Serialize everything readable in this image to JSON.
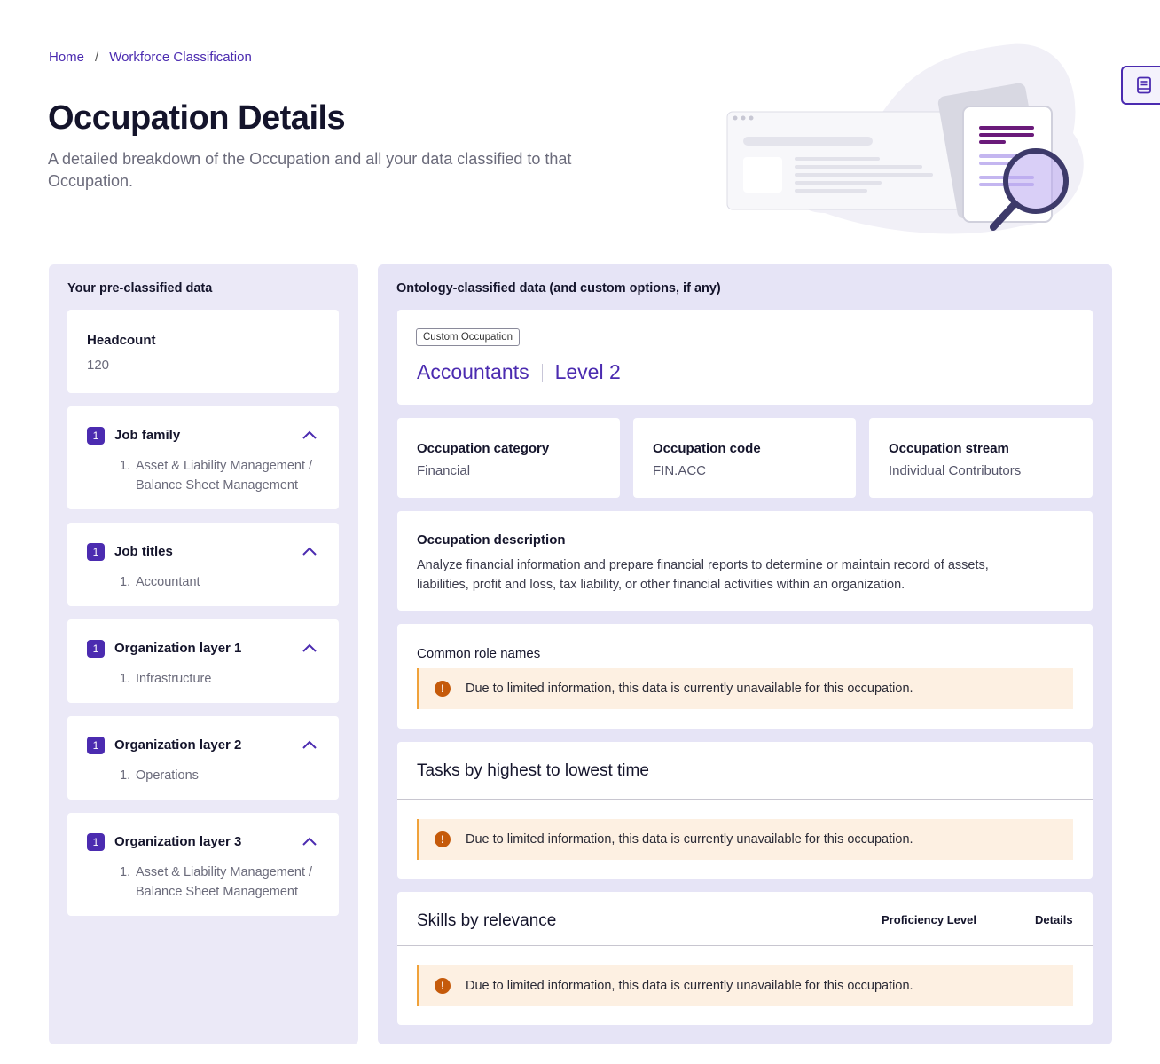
{
  "breadcrumb": {
    "home": "Home",
    "separator": "/",
    "current": "Workforce Classification"
  },
  "page": {
    "title": "Occupation Details",
    "subtitle": "A detailed breakdown of the Occupation and all your data classified to that Occupation."
  },
  "left_panel": {
    "heading": "Your pre-classified data",
    "headcount": {
      "label": "Headcount",
      "value": "120"
    },
    "groups": [
      {
        "badge": "1",
        "label": "Job family",
        "items": [
          {
            "num": "1.",
            "text": "Asset & Liability Management / Balance Sheet Management"
          }
        ]
      },
      {
        "badge": "1",
        "label": "Job titles",
        "items": [
          {
            "num": "1.",
            "text": "Accountant"
          }
        ]
      },
      {
        "badge": "1",
        "label": "Organization layer 1",
        "items": [
          {
            "num": "1.",
            "text": "Infrastructure"
          }
        ]
      },
      {
        "badge": "1",
        "label": "Organization layer 2",
        "items": [
          {
            "num": "1.",
            "text": "Operations"
          }
        ]
      },
      {
        "badge": "1",
        "label": "Organization layer 3",
        "items": [
          {
            "num": "1.",
            "text": "Asset & Liability Management / Balance Sheet Management"
          }
        ]
      }
    ]
  },
  "right_panel": {
    "heading": "Ontology-classified data (and custom options, if any)",
    "tag": "Custom Occupation",
    "occupation_name": "Accountants",
    "occupation_level": "Level 2",
    "category": {
      "label": "Occupation category",
      "value": "Financial"
    },
    "code": {
      "label": "Occupation code",
      "value": "FIN.ACC"
    },
    "stream": {
      "label": "Occupation stream",
      "value": "Individual Contributors"
    },
    "description": {
      "label": "Occupation description",
      "text": "Analyze financial information and prepare financial reports to determine or maintain record of assets, liabilities, profit and loss, tax liability, or other financial activities within an organization."
    },
    "role_names": {
      "label": "Common role names"
    },
    "tasks": {
      "title": "Tasks by highest to lowest time"
    },
    "skills": {
      "title": "Skills by relevance",
      "col_proficiency": "Proficiency Level",
      "col_details": "Details"
    },
    "alert_text": "Due to limited information, this data is currently unavailable for this occupation.",
    "alert_icon": "!"
  },
  "colors": {
    "accent": "#4b2bb0",
    "alert_bg": "#fdf0e2",
    "alert_border": "#f0a23a",
    "alert_icon": "#c55a0a"
  }
}
